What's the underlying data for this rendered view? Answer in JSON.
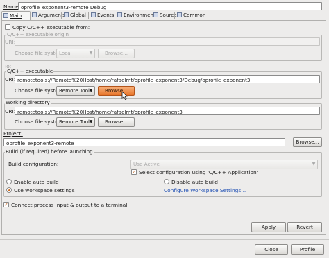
{
  "name": {
    "label": "Name:",
    "value": "oprofile_exponent3-remote Debug"
  },
  "tabs": [
    {
      "label": "Main",
      "icon": "main-tab-icon"
    },
    {
      "label": "Arguments",
      "icon": "arguments-tab-icon"
    },
    {
      "label": "Global",
      "icon": "global-tab-icon"
    },
    {
      "label": "Events",
      "icon": "events-tab-icon"
    },
    {
      "label": "Environment",
      "icon": "environment-tab-icon"
    },
    {
      "label": "Source",
      "icon": "source-tab-icon"
    },
    {
      "label": "Common",
      "icon": "common-tab-icon"
    }
  ],
  "copy_executable": {
    "label": "Copy C/C++ executable from:",
    "checked": false
  },
  "origin": {
    "legend": "C/C++ executable origin",
    "uri_label": "URI:",
    "uri_value": "",
    "fs_label": "Choose file system:",
    "fs_value": "Local",
    "browse": "Browse..."
  },
  "to_label": "To:",
  "executable": {
    "legend": "C/C++ executable",
    "uri_label": "URI:",
    "uri_value": "remotetools://Remote%20Host/home/rafaelmt/oprofile_exponent3/Debug/oprofile_exponent3",
    "fs_label": "Choose file system:",
    "fs_value": "Remote Tools",
    "browse": "Browse..."
  },
  "working_dir": {
    "legend": "Working directory",
    "uri_label": "URI:",
    "uri_value": "remotetools://Remote%20Host/home/rafaelmt/oprofile_exponent3",
    "fs_label": "Choose file system:",
    "fs_value": "Remote Tools",
    "browse": "Browse..."
  },
  "project": {
    "label": "Project:",
    "value": "oprofile_exponent3-remote",
    "browse": "Browse..."
  },
  "build": {
    "legend": "Build (if required) before launching",
    "config_label": "Build configuration:",
    "config_value": "Use Active",
    "select_config_label": "Select configuration using 'C/C++ Application'",
    "select_config_checked": true,
    "enable_auto": "Enable auto build",
    "disable_auto": "Disable auto build",
    "workspace_settings": "Use workspace settings",
    "configure_link": "Configure Workspace Settings..."
  },
  "connect_process": {
    "label": "Connect process input & output to a terminal.",
    "checked": true
  },
  "buttons": {
    "apply": "Apply",
    "revert": "Revert",
    "close": "Close",
    "profile": "Profile"
  },
  "colors": {
    "accent": "#e8752a",
    "link": "#1f4fb3"
  }
}
